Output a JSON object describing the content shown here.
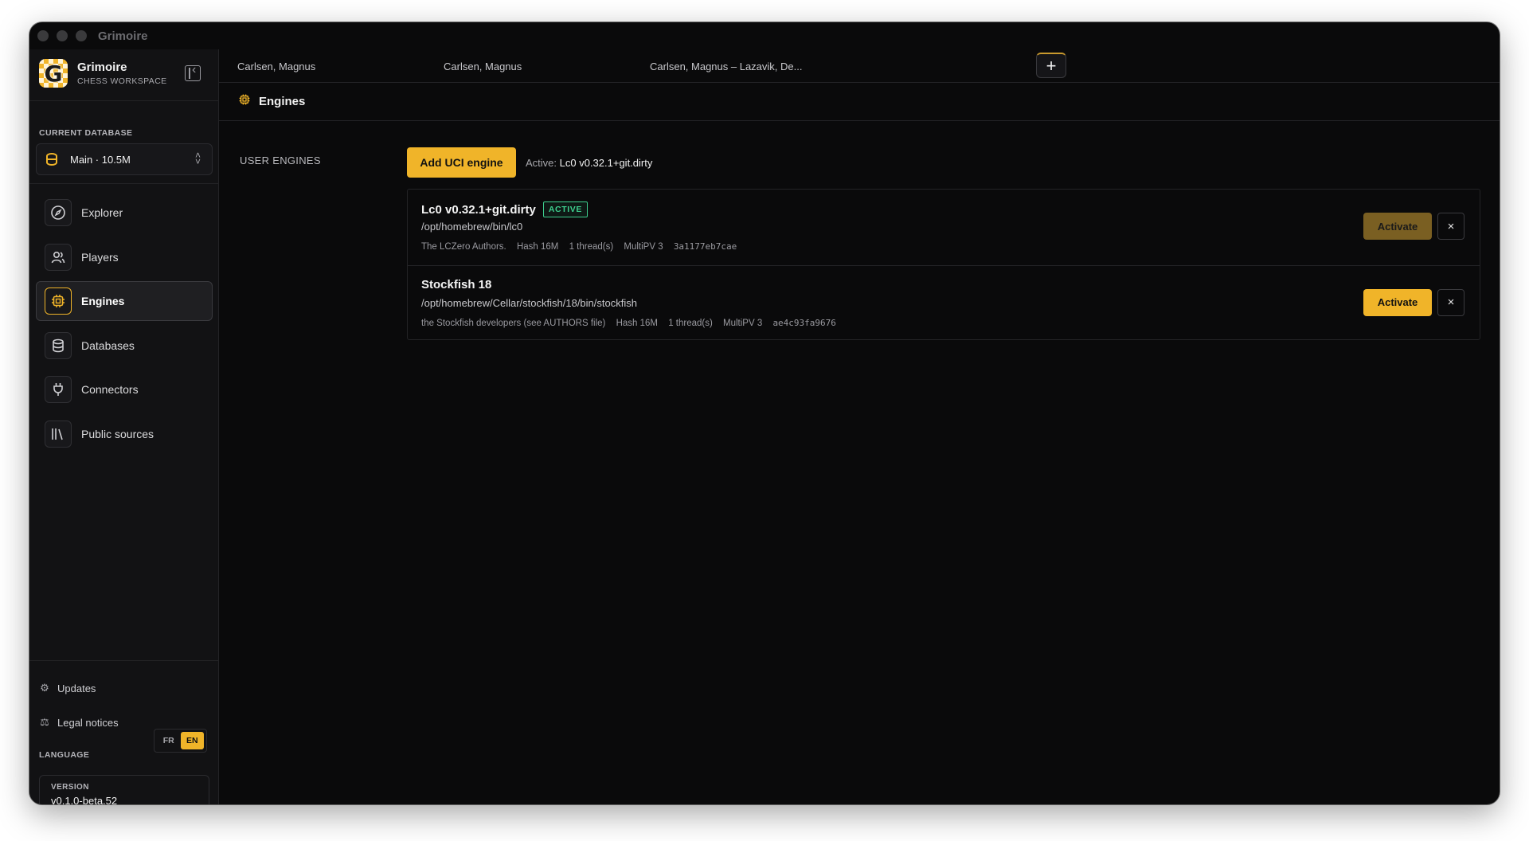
{
  "window": {
    "title": "Grimoire"
  },
  "brand": {
    "name": "Grimoire",
    "subtitle": "CHESS WORKSPACE",
    "logo_letter": "G"
  },
  "database": {
    "section_label": "CURRENT DATABASE",
    "selected": "Main · 10.5M"
  },
  "nav": [
    {
      "label": "Explorer",
      "icon": "compass-icon"
    },
    {
      "label": "Players",
      "icon": "users-icon"
    },
    {
      "label": "Engines",
      "icon": "cpu-icon",
      "active": true
    },
    {
      "label": "Databases",
      "icon": "database-icon"
    },
    {
      "label": "Connectors",
      "icon": "plug-icon"
    },
    {
      "label": "Public sources",
      "icon": "library-icon"
    }
  ],
  "footer": {
    "updates_label": "Updates",
    "legal_label": "Legal notices",
    "language_label": "LANGUAGE",
    "languages": [
      "FR",
      "EN"
    ],
    "selected_language": "EN",
    "version_label": "VERSION",
    "version_value": "v0.1.0-beta.52"
  },
  "tabs": [
    {
      "label": "Carlsen, Magnus"
    },
    {
      "label": "Carlsen, Magnus"
    },
    {
      "label": "Carlsen, Magnus – Lazavik, De..."
    }
  ],
  "page": {
    "title": "Engines",
    "section_label": "USER ENGINES",
    "add_button": "Add UCI engine",
    "active_prefix": "Active:",
    "active_engine": "Lc0 v0.32.1+git.dirty"
  },
  "engines": [
    {
      "name": "Lc0 v0.32.1+git.dirty",
      "badge": "ACTIVE",
      "path": "/opt/homebrew/bin/lc0",
      "author": "The LCZero Authors.",
      "hash": "Hash 16M",
      "threads": "1 thread(s)",
      "multipv": "MultiPV 3",
      "id": "3a1177eb7cae",
      "activate_label": "Activate",
      "remove_label": "×"
    },
    {
      "name": "Stockfish 18",
      "badge": "",
      "path": "/opt/homebrew/Cellar/stockfish/18/bin/stockfish",
      "author": "the Stockfish developers (see AUTHORS file)",
      "hash": "Hash 16M",
      "threads": "1 thread(s)",
      "multipv": "MultiPV 3",
      "id": "ae4c93fa9676",
      "activate_label": "Activate",
      "remove_label": "×"
    }
  ],
  "colors": {
    "accent": "#f0b429",
    "active_badge": "#3ecf8e",
    "background": "#0a0a0b",
    "sidebar": "#121214"
  }
}
